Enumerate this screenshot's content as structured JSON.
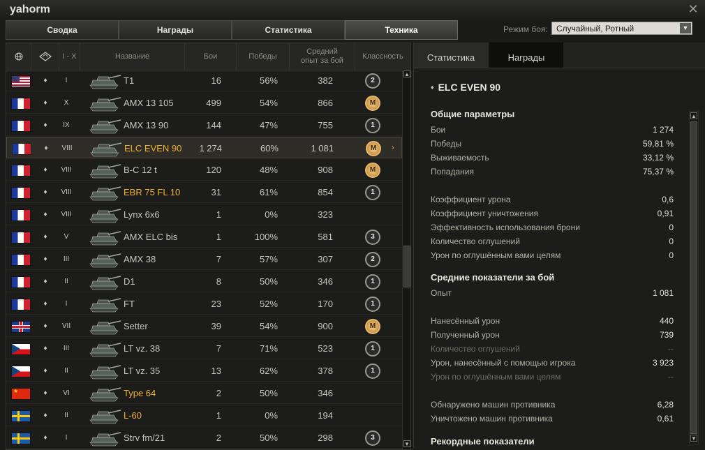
{
  "window": {
    "title": "yahorm"
  },
  "tabs": [
    "Сводка",
    "Награды",
    "Статистика",
    "Техника"
  ],
  "mode": {
    "label": "Режим боя:",
    "value": "Случайный, Ротный"
  },
  "table": {
    "headers": {
      "name": "Название",
      "battles": "Бои",
      "wins": "Победы",
      "avgxp_line1": "Средний",
      "avgxp_line2": "опыт за бой",
      "mastery": "Классность",
      "tier": "I - X"
    },
    "rows": [
      {
        "flag": "usa",
        "type": "♦",
        "tier": "I",
        "name": "T1",
        "premium": false,
        "battles": "16",
        "wins": "56%",
        "avgxp": "382",
        "mastery": "2"
      },
      {
        "flag": "fr",
        "type": "♦",
        "tier": "X",
        "name": "AMX 13 105",
        "premium": false,
        "battles": "499",
        "wins": "54%",
        "avgxp": "866",
        "mastery": "M"
      },
      {
        "flag": "fr",
        "type": "♦",
        "tier": "IX",
        "name": "AMX 13 90",
        "premium": false,
        "battles": "144",
        "wins": "47%",
        "avgxp": "755",
        "mastery": "1"
      },
      {
        "flag": "fr",
        "type": "♦",
        "tier": "VIII",
        "name": "ELC EVEN 90",
        "premium": true,
        "battles": "1 274",
        "wins": "60%",
        "avgxp": "1 081",
        "mastery": "M",
        "selected": true
      },
      {
        "flag": "fr",
        "type": "♦",
        "tier": "VIII",
        "name": "B-C 12 t",
        "premium": false,
        "battles": "120",
        "wins": "48%",
        "avgxp": "908",
        "mastery": "M"
      },
      {
        "flag": "fr",
        "type": "♦",
        "tier": "VIII",
        "name": "EBR 75 FL 10",
        "premium": true,
        "battles": "31",
        "wins": "61%",
        "avgxp": "854",
        "mastery": "1"
      },
      {
        "flag": "fr",
        "type": "♦",
        "tier": "VIII",
        "name": "Lynx 6x6",
        "premium": false,
        "battles": "1",
        "wins": "0%",
        "avgxp": "323",
        "mastery": ""
      },
      {
        "flag": "fr",
        "type": "♦",
        "tier": "V",
        "name": "AMX ELC bis",
        "premium": false,
        "battles": "1",
        "wins": "100%",
        "avgxp": "581",
        "mastery": "3"
      },
      {
        "flag": "fr",
        "type": "♦",
        "tier": "III",
        "name": "AMX 38",
        "premium": false,
        "battles": "7",
        "wins": "57%",
        "avgxp": "307",
        "mastery": "2"
      },
      {
        "flag": "fr",
        "type": "♦",
        "tier": "II",
        "name": "D1",
        "premium": false,
        "battles": "8",
        "wins": "50%",
        "avgxp": "346",
        "mastery": "1"
      },
      {
        "flag": "fr",
        "type": "♦",
        "tier": "I",
        "name": "FT",
        "premium": false,
        "battles": "23",
        "wins": "52%",
        "avgxp": "170",
        "mastery": "1"
      },
      {
        "flag": "uk",
        "type": "♦",
        "tier": "VII",
        "name": "Setter",
        "premium": false,
        "battles": "39",
        "wins": "54%",
        "avgxp": "900",
        "mastery": "M"
      },
      {
        "flag": "cz",
        "type": "♦",
        "tier": "III",
        "name": "LT vz. 38",
        "premium": false,
        "battles": "7",
        "wins": "71%",
        "avgxp": "523",
        "mastery": "1"
      },
      {
        "flag": "cz",
        "type": "♦",
        "tier": "II",
        "name": "LT vz. 35",
        "premium": false,
        "battles": "13",
        "wins": "62%",
        "avgxp": "378",
        "mastery": "1"
      },
      {
        "flag": "cn",
        "type": "♦",
        "tier": "VI",
        "name": "Type 64",
        "premium": true,
        "battles": "2",
        "wins": "50%",
        "avgxp": "346",
        "mastery": ""
      },
      {
        "flag": "se",
        "type": "♦",
        "tier": "II",
        "name": "L-60",
        "premium": true,
        "battles": "1",
        "wins": "0%",
        "avgxp": "194",
        "mastery": ""
      },
      {
        "flag": "se",
        "type": "♦",
        "tier": "I",
        "name": "Strv fm/21",
        "premium": false,
        "battles": "2",
        "wins": "50%",
        "avgxp": "298",
        "mastery": "3"
      }
    ]
  },
  "details": {
    "tabs": [
      "Статистика",
      "Награды"
    ],
    "vehicle": "ELC EVEN 90",
    "sections": {
      "general": "Общие параметры",
      "avg": "Средние показатели за бой",
      "records": "Рекордные показатели"
    },
    "general": [
      {
        "label": "Бои",
        "value": "1 274"
      },
      {
        "label": "Победы",
        "value": "59,81 %"
      },
      {
        "label": "Выживаемость",
        "value": "33,12 %"
      },
      {
        "label": "Попадания",
        "value": "75,37 %"
      }
    ],
    "coef": [
      {
        "label": "Коэффициент урона",
        "value": "0,6"
      },
      {
        "label": "Коэффициент уничтожения",
        "value": "0,91"
      },
      {
        "label": "Эффективность использования брони",
        "value": "0"
      },
      {
        "label": "Количество оглушений",
        "value": "0"
      },
      {
        "label": "Урон по оглушённым вами целям",
        "value": "0"
      }
    ],
    "avg_xp": {
      "label": "Опыт",
      "value": "1 081"
    },
    "avg_dmg": [
      {
        "label": "Нанесённый урон",
        "value": "440"
      },
      {
        "label": "Полученный урон",
        "value": "739"
      },
      {
        "label": "Количество оглушений",
        "value": "--",
        "dim": true
      },
      {
        "label": "Урон, нанесённый с помощью игрока",
        "value": "3 923"
      },
      {
        "label": "Урон по оглушённым вами целям",
        "value": "--",
        "dim": true
      }
    ],
    "avg_kills": [
      {
        "label": "Обнаружено машин противника",
        "value": "6,28"
      },
      {
        "label": "Уничтожено машин противника",
        "value": "0,61"
      }
    ]
  }
}
